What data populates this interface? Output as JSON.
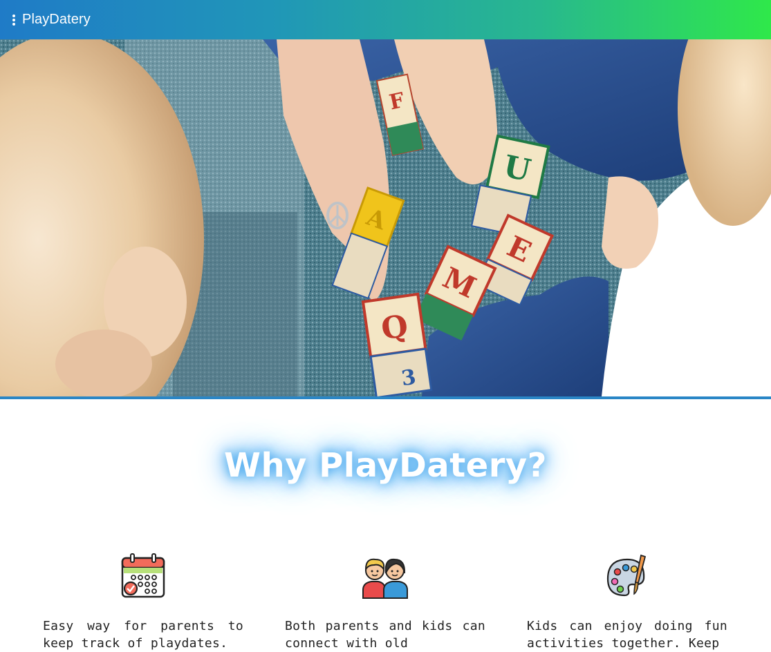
{
  "header": {
    "brand": "PlayDatery",
    "menu_icon": "more-vertical-icon"
  },
  "hero": {
    "image": "children-playing-alphabet-blocks",
    "block_letters": [
      "F",
      "U",
      "E",
      "M",
      "A",
      "Q",
      "3"
    ]
  },
  "section": {
    "title": "Why PlayDatery?"
  },
  "features": [
    {
      "icon": "calendar-icon",
      "text": "Easy way for parents to keep track of playdates."
    },
    {
      "icon": "kids-friends-icon",
      "text": "Both parents and kids can connect with old"
    },
    {
      "icon": "paint-palette-icon",
      "text": "Kids can enjoy doing fun activities together. Keep"
    }
  ],
  "colors": {
    "header_gradient_start": "#1f7bc7",
    "header_gradient_end": "#2fe84a",
    "title_glow": "#4aa8ee",
    "hero_border": "#2a86c6"
  }
}
